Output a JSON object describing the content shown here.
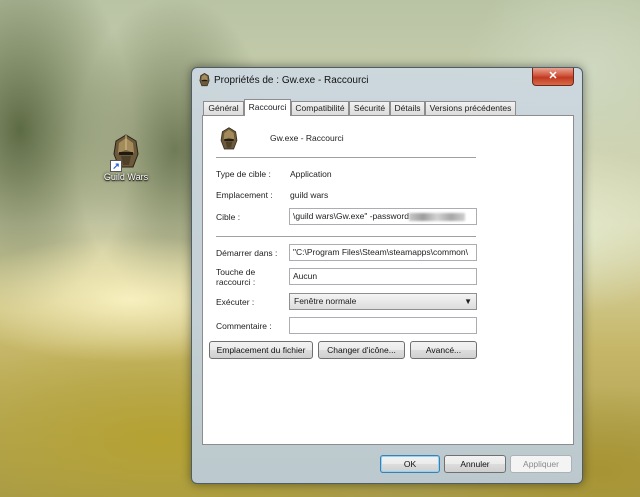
{
  "desktop": {
    "icon_label": "Guild Wars"
  },
  "window": {
    "title": "Propriétés de : Gw.exe - Raccourci",
    "close_glyph": "✕"
  },
  "tabs": [
    {
      "label": "Général"
    },
    {
      "label": "Raccourci"
    },
    {
      "label": "Compatibilité"
    },
    {
      "label": "Sécurité"
    },
    {
      "label": "Détails"
    },
    {
      "label": "Versions précédentes"
    }
  ],
  "shortcut": {
    "name": "Gw.exe - Raccourci",
    "type_label": "Type de cible :",
    "type_value": "Application",
    "location_label": "Emplacement :",
    "location_value": "guild wars",
    "target_label": "Cible :",
    "target_value": "\\guild wars\\Gw.exe\" -password",
    "start_label": "Démarrer dans :",
    "start_value": "\"C:\\Program Files\\Steam\\steamapps\\common\\",
    "hotkey_label": "Touche de raccourci :",
    "hotkey_value": "Aucun",
    "run_label": "Exécuter :",
    "run_value": "Fenêtre normale",
    "comment_label": "Commentaire :",
    "comment_value": ""
  },
  "buttons": {
    "open_location": "Emplacement du fichier",
    "change_icon": "Changer d'icône...",
    "advanced": "Avancé...",
    "ok": "OK",
    "cancel": "Annuler",
    "apply": "Appliquer"
  },
  "colors": {
    "accent": "#3c7fb1",
    "close_button": "#c03a22"
  }
}
